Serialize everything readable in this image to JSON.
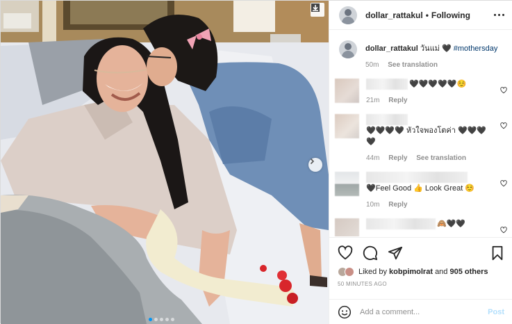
{
  "post": {
    "image_alt": "",
    "carousel": {
      "count": 5,
      "active": 0
    }
  },
  "header": {
    "username": "dollar_rattakul",
    "separator": "•",
    "follow_status": "Following"
  },
  "caption": {
    "username": "dollar_rattakul",
    "text": "วันแม่ 🖤",
    "hashtag": "#mothersday",
    "time": "50m",
    "translate": "See translation"
  },
  "comments": [
    {
      "text": "🖤🖤🖤🖤🖤☺️",
      "time": "21m",
      "reply": "Reply",
      "translate": ""
    },
    {
      "text": "🖤🖤🖤🖤 หัวใจพองโตค่า 🖤🖤🖤🖤",
      "time": "44m",
      "reply": "Reply",
      "translate": "See translation"
    },
    {
      "text": "🖤Feel Good 👍 Look Great ☺️",
      "time": "10m",
      "reply": "Reply",
      "translate": ""
    },
    {
      "text": "🙈🖤🖤",
      "time": "",
      "reply": "",
      "translate": ""
    }
  ],
  "actions": {
    "liked_by_prefix": "Liked by",
    "liked_by_user": "kobpimolrat",
    "and": "and",
    "others": "905 others",
    "time_ago": "50 MINUTES AGO"
  },
  "comment_box": {
    "placeholder": "Add a comment...",
    "post_label": "Post"
  },
  "icons": [
    "save-corner-icon",
    "next-arrow-icon",
    "heart-icon",
    "comment-icon",
    "share-icon",
    "bookmark-icon",
    "emoji-icon",
    "more-icon"
  ],
  "colors": {
    "link": "#00376b",
    "accent": "#0095f6",
    "post_disabled": "#b2dffc",
    "muted": "#8e8e8e"
  }
}
